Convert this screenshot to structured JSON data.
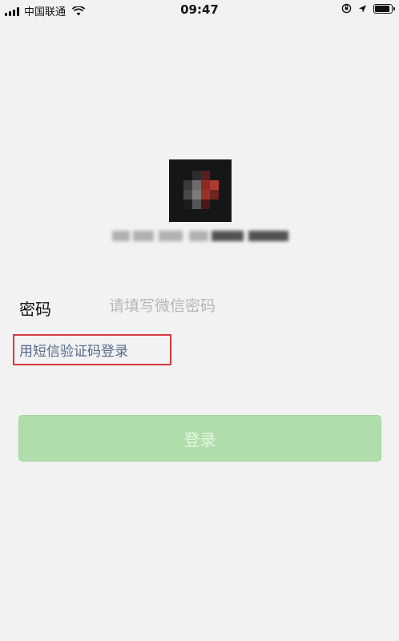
{
  "status_bar": {
    "carrier": "中国联通",
    "time": "09:47"
  },
  "password": {
    "label": "密码",
    "placeholder": "请填写微信密码"
  },
  "sms_login": {
    "label": "用短信验证码登录",
    "highlight_color": "#d9383a"
  },
  "login_button": {
    "label": "登录",
    "color": "#b0deaa"
  },
  "icons": {
    "signal": "signal-icon",
    "wifi": "wifi-icon",
    "location": "location-icon",
    "orientation_lock": "orientation-lock-icon",
    "battery": "battery-icon"
  }
}
